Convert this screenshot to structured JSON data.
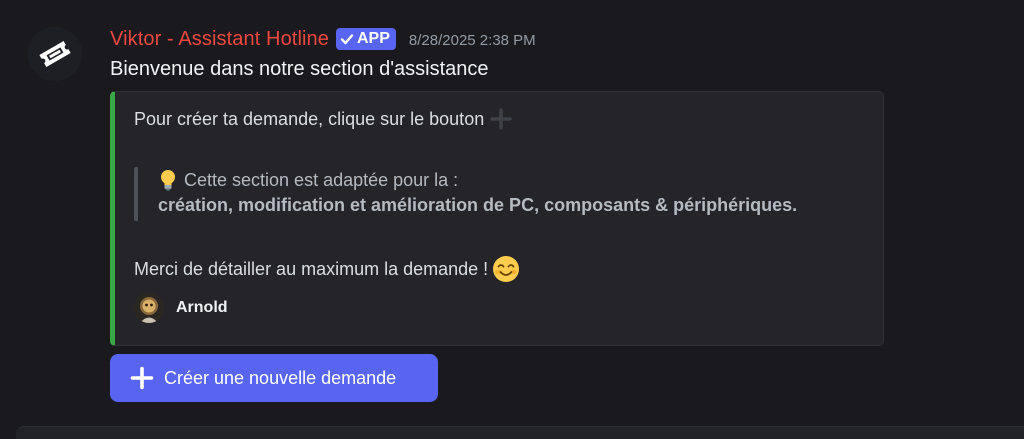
{
  "message": {
    "username": "Viktor - Assistant Hotline",
    "badge": "APP",
    "timestamp": "8/28/2025 2:38 PM",
    "content": "Bienvenue dans notre section d'assistance",
    "avatar_icon": "ticket-icon"
  },
  "embed": {
    "accent_color": "#3aa645",
    "line1": "Pour créer ta demande, clique sur le bouton",
    "quote_line1": "Cette section est adaptée pour la :",
    "quote_line2": "création, modification et amélioration de PC, composants & périphériques.",
    "line3": "Merci de détailler au maximum la demande !",
    "author": "Arnold"
  },
  "button": {
    "label": "Créer une nouvelle demande",
    "color": "#5865f2",
    "icon": "plus-icon"
  },
  "colors": {
    "username": "#f0473f",
    "badge": "#5865f2",
    "background": "#1a1a1e"
  }
}
